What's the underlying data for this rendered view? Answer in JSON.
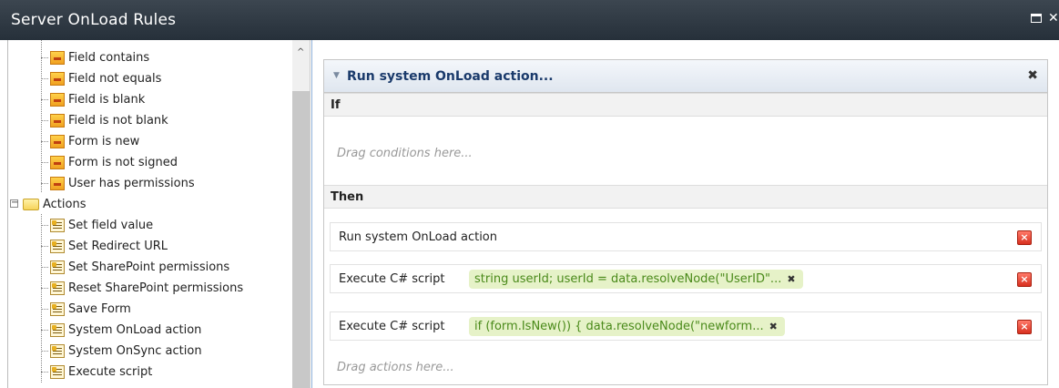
{
  "window": {
    "title": "Server OnLoad Rules",
    "close_glyph": "✕"
  },
  "tree": {
    "conditions": [
      "Field contains",
      "Field not equals",
      "Field is blank",
      "Field is not blank",
      "Form is new",
      "Form is not signed",
      "User has permissions"
    ],
    "actions_folder": {
      "label": "Actions",
      "expander": "−"
    },
    "actions": [
      "Set field value",
      "Set Redirect URL",
      "Set SharePoint permissions",
      "Reset SharePoint permissions",
      "Save Form",
      "System OnLoad action",
      "System OnSync action",
      "Execute script"
    ],
    "scroll_up_glyph": "^"
  },
  "rule": {
    "title": "Run system OnLoad action...",
    "caret": "▼",
    "remove_glyph": "✖",
    "if_label": "If",
    "conditions_placeholder": "Drag conditions here...",
    "then_label": "Then",
    "actions": [
      {
        "label": "Run system OnLoad action",
        "chip": ""
      },
      {
        "label": "Execute C# script",
        "chip": "string userId; userId = data.resolveNode(\"UserID\"..."
      },
      {
        "label": "Execute C# script",
        "chip": "if (form.IsNew()) { data.resolveNode(\"newform..."
      }
    ],
    "actions_placeholder": "Drag actions here...",
    "chip_remove_glyph": "✖",
    "delete_glyph": "×"
  },
  "colors": {
    "title_bar": "#2f3943",
    "rule_title": "#1a3a6b",
    "chip_bg": "#e6f2c8",
    "chip_text": "#4a8a1a",
    "delete_red": "#d8301f"
  }
}
